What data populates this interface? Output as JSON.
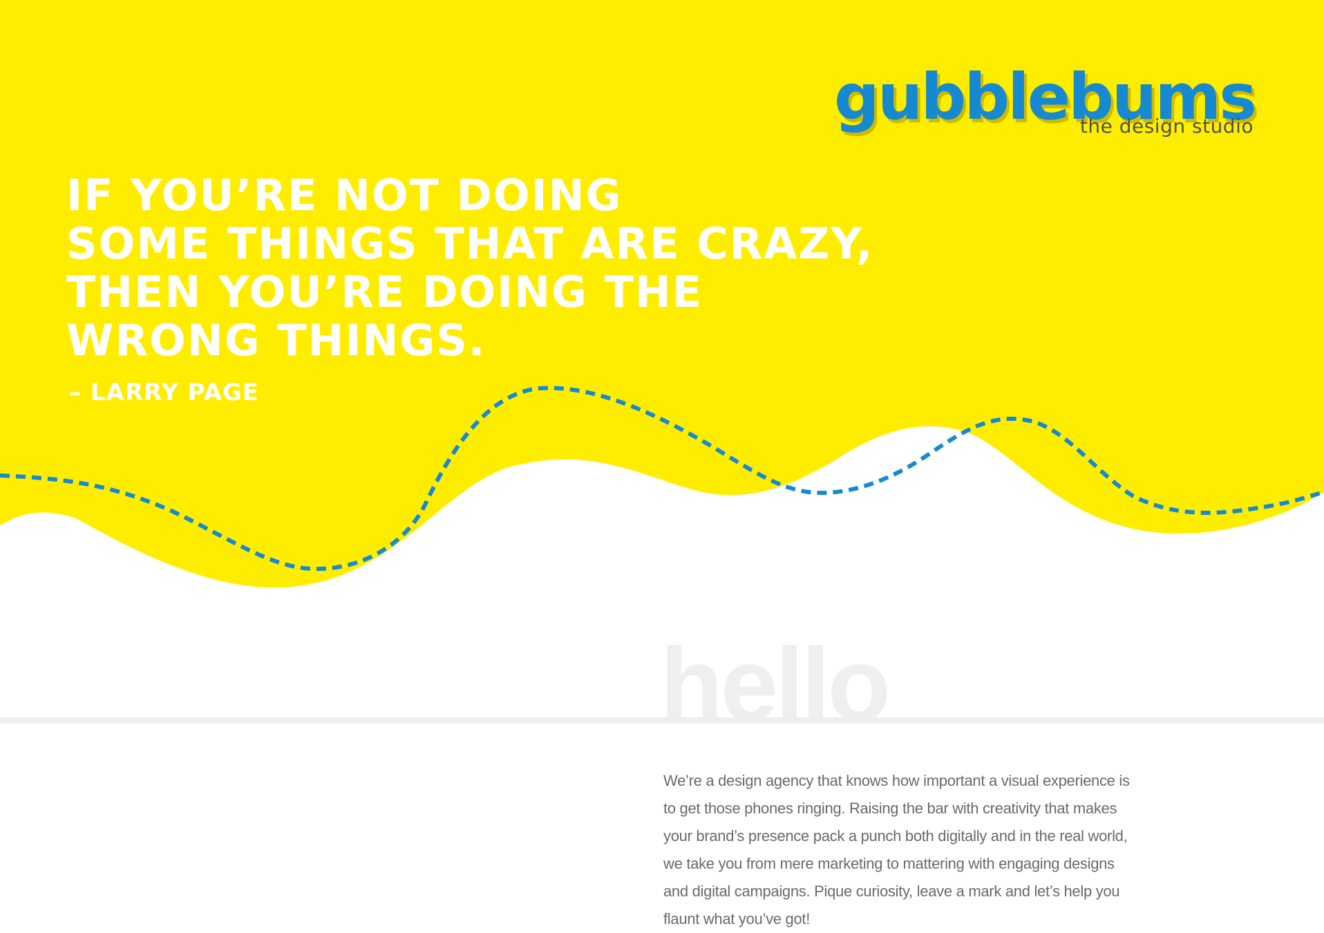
{
  "colors": {
    "background_yellow": "#ffed00",
    "accent_blue": "#1689d1",
    "white": "#ffffff",
    "text_gray": "#6a6a6a",
    "divider_gray": "#eeeeee",
    "hello_gray": "#efefef"
  },
  "logo": {
    "wordmark": "gubblebums",
    "tagline": "the design studio"
  },
  "hero": {
    "quote_lines": [
      "IF YOU’RE NOT DOING",
      "SOME THINGS THAT ARE CRAZY,",
      "THEN YOU’RE DOING THE",
      "WRONG THINGS."
    ],
    "author": "– LARRY PAGE"
  },
  "intro": {
    "heading": "hello",
    "body": "We’re a design agency that knows how important a visual experience is to get those phones ringing. Raising the bar with creativity that makes your brand’s presence pack a punch both digitally and in the real world, we take you from mere marketing to mattering with engaging designs and digital campaigns. Pique curiosity, leave a mark and let’s help you flaunt what you’ve got!"
  }
}
